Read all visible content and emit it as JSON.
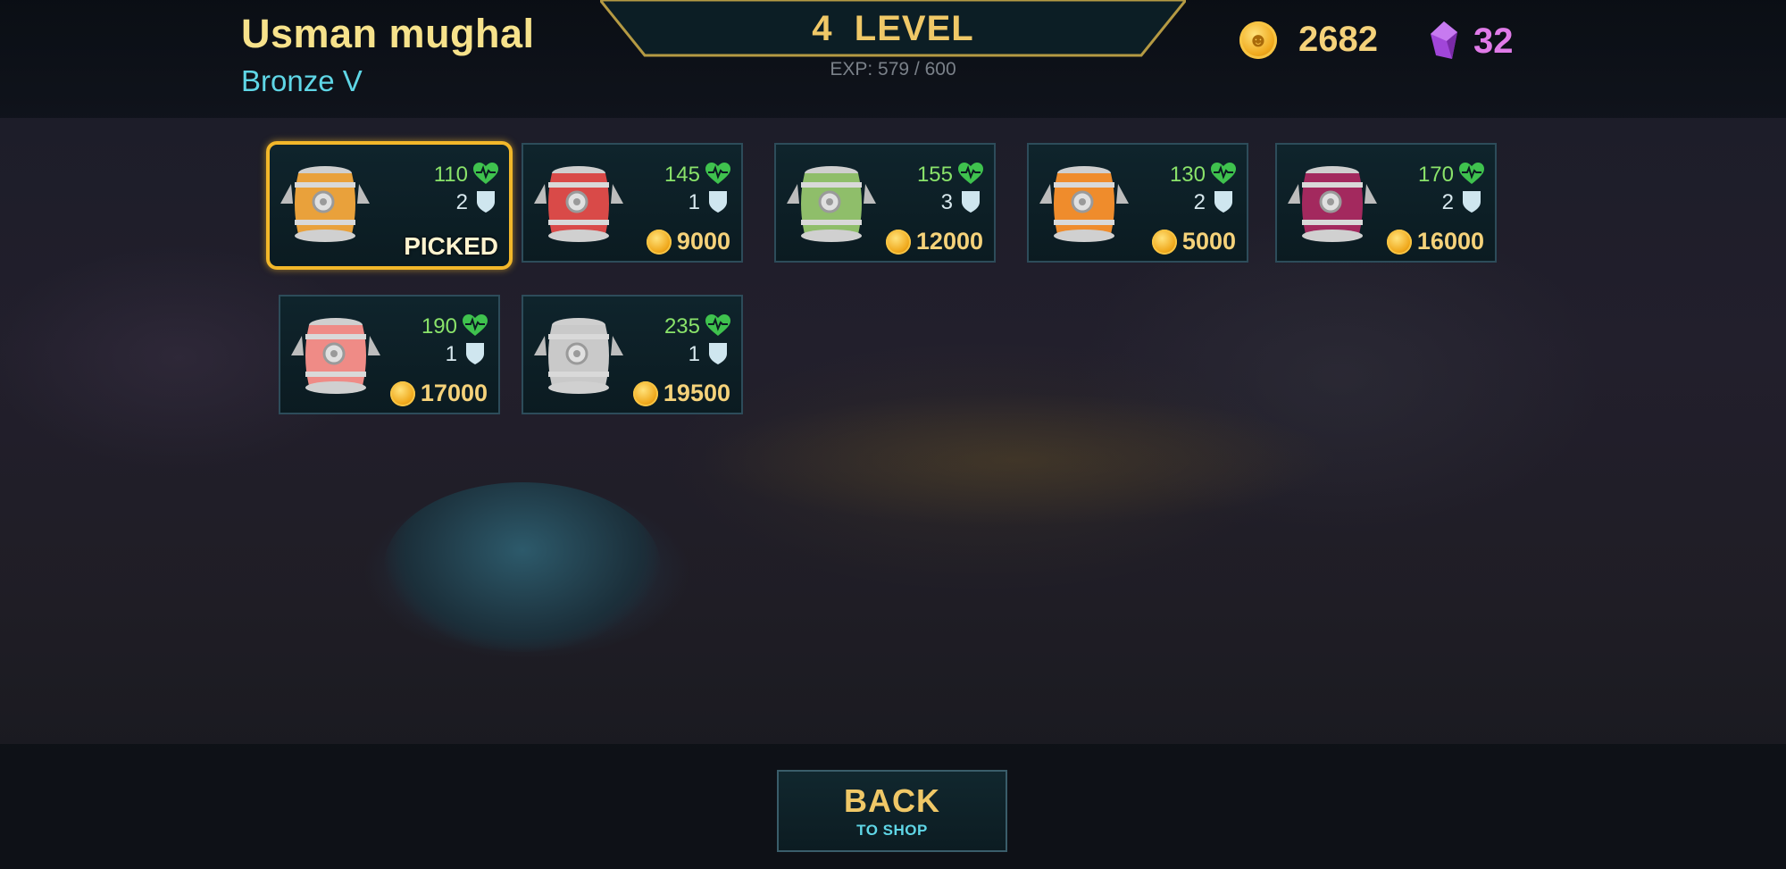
{
  "player": {
    "name": "Usman mughal",
    "rank": "Bronze V"
  },
  "level": {
    "label": "4  LEVEL",
    "exp": "EXP: 579 / 600"
  },
  "currencies": {
    "coins": "2682",
    "gems": "32"
  },
  "colors": {
    "gold": "#f0c867",
    "cyan": "#5fd6e6",
    "hp_green": "#8ae36a",
    "picked_border": "#f2b72a",
    "gems_pink": "#e07be8"
  },
  "barrels": [
    {
      "hp": "110",
      "defense": "2",
      "status": "PICKED",
      "price": "",
      "color": "#e9a13b",
      "picked": true
    },
    {
      "hp": "145",
      "defense": "1",
      "status": "",
      "price": "9000",
      "color": "#d94a48",
      "picked": false
    },
    {
      "hp": "155",
      "defense": "3",
      "status": "",
      "price": "12000",
      "color": "#8fbe6a",
      "picked": false
    },
    {
      "hp": "130",
      "defense": "2",
      "status": "",
      "price": "5000",
      "color": "#ef8c2c",
      "picked": false
    },
    {
      "hp": "170",
      "defense": "2",
      "status": "",
      "price": "16000",
      "color": "#a3295e",
      "picked": false
    },
    {
      "hp": "190",
      "defense": "1",
      "status": "",
      "price": "17000",
      "color": "#ef8b86",
      "picked": false
    },
    {
      "hp": "235",
      "defense": "1",
      "status": "",
      "price": "19500",
      "color": "#c9c9c9",
      "picked": false
    }
  ],
  "back_button": {
    "title": "BACK",
    "subtitle": "TO SHOP"
  }
}
